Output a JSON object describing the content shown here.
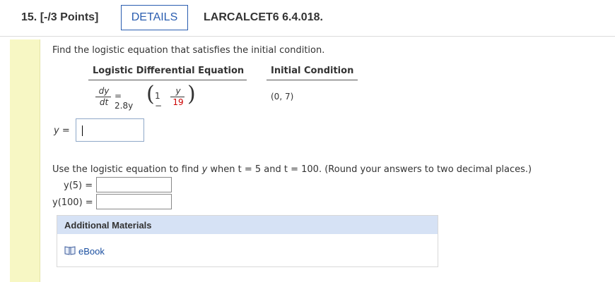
{
  "header": {
    "question_number": "15.",
    "points": "[-/3 Points]",
    "details_label": "DETAILS",
    "course_code": "LARCALCET6 6.4.018."
  },
  "problem": {
    "prompt": "Find the logistic equation that satisfies the initial condition.",
    "col_left_heading": "Logistic Differential Equation",
    "col_right_heading": "Initial Condition",
    "equation": {
      "dy": "dy",
      "dt": "dt",
      "equals_coef": "= 2.8y",
      "one_minus": "1 −",
      "y": "y",
      "carrying_capacity": "19"
    },
    "initial_condition": "(0, 7)",
    "y_label": "y =",
    "y_input_value": ""
  },
  "part2": {
    "instruction_prefix": "Use the logistic equation to find ",
    "instruction_var": "y",
    "instruction_suffix": " when  t = 5  and  t = 100.  (Round your answers to two decimal places.)",
    "y5_label": "y(5) =",
    "y5_value": "",
    "y100_label": "y(100) =",
    "y100_value": ""
  },
  "additional": {
    "title": "Additional Materials",
    "ebook_label": "eBook",
    "ebook_icon": "book-icon"
  }
}
